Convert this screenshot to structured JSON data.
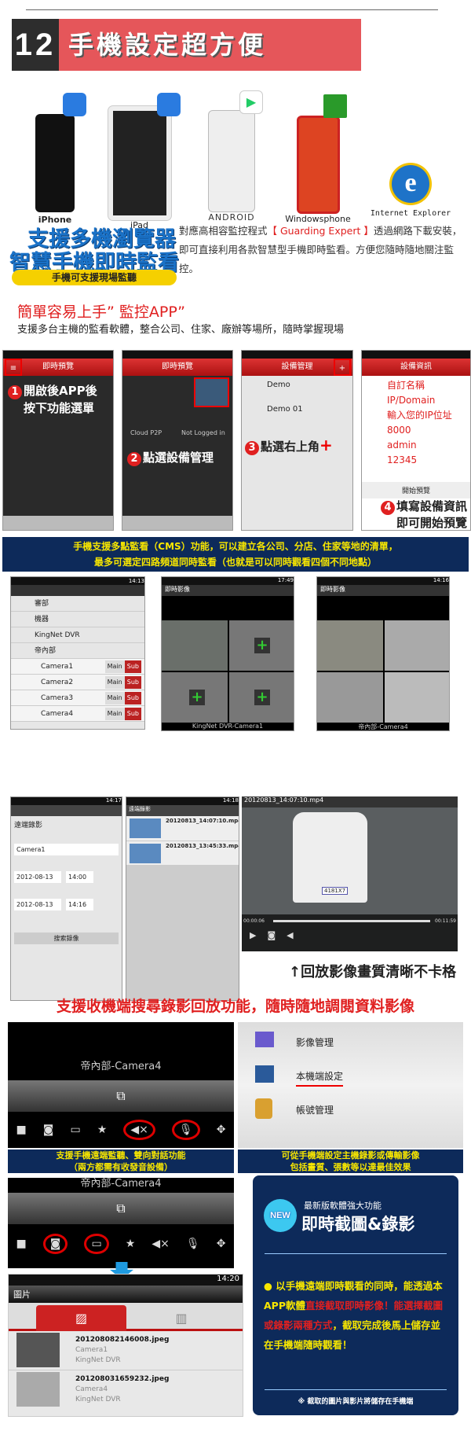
{
  "header": {
    "number": "12",
    "title": "手機設定超方便"
  },
  "devices": [
    {
      "label": "iPhone",
      "icon": "app-store-icon"
    },
    {
      "label": "iPad",
      "icon": "app-store-icon"
    },
    {
      "label": "ANDROID",
      "icon": "google-play-icon"
    },
    {
      "label": "Windowsphone",
      "icon": "windows-store-icon"
    },
    {
      "label": "Internet Explorer",
      "icon": "ie-icon"
    }
  ],
  "intro": {
    "headline1": "支援多機瀏覽器",
    "headline2": "智慧手機即時監看",
    "pill": "手機可支援現場監聽",
    "para_pre": "對應高相容監控程式",
    "para_brand": "【 Guarding Expert 】",
    "para_post": "透過網路下載安裝，即可直接利用各款智慧型手機即時監看。方便您隨時隨地關注監控。"
  },
  "easy": {
    "title": "簡單容易上手” 監控APP”",
    "subtitle": "支援多台主機的監看軟體，整合公司、住家、廠辦等場所，隨時掌握現場"
  },
  "steps": [
    {
      "num": "1",
      "text1": "開啟後APP後",
      "text2": "按下功能選單",
      "screen_title": "即時預覽"
    },
    {
      "num": "2",
      "text1": "點選設備管理",
      "screen_title": "即時預覽",
      "cloud": "Cloud P2P",
      "not_logged": "Not Logged in"
    },
    {
      "num": "3",
      "text1": "點選右上角",
      "plus": "+",
      "screen_title": "設備管理",
      "items": [
        "Demo",
        "Demo 01"
      ]
    },
    {
      "num": "4",
      "text1": "填寫設備資訊",
      "text2": "即可開始預覽",
      "screen_title": "設備資訊",
      "fields": [
        "自訂名稱",
        "IP/Domain",
        "輸入您的IP位址",
        "8000",
        "admin",
        "12345"
      ],
      "start": "開始預覽"
    }
  ],
  "cms_banner": {
    "line1": "手機支援多點監看（CMS）功能，可以建立各公司、分店、住家等地的清單，",
    "line2": "最多可選定四路頻道同時監看（也就是可以同時觀看四個不同地點）"
  },
  "list_screen": {
    "time": "14:13",
    "groups": [
      "審部",
      "機器",
      "KingNet DVR",
      "帝內部"
    ],
    "cameras": [
      "Camera1",
      "Camera2",
      "Camera3",
      "Camera4"
    ],
    "main": "Main",
    "sub": "Sub"
  },
  "live1": {
    "time": "17:49",
    "title": "即時影像",
    "caption": "KingNet DVR-Camera1"
  },
  "live2": {
    "time": "14:16",
    "title": "即時影像",
    "caption": "帝內部-Camera4"
  },
  "search_screen": {
    "time": "14:17",
    "title": "遠端錄影",
    "channel": "Camera1",
    "start_date": "2012-08-13",
    "start_time": "14:00",
    "end_date": "2012-08-13",
    "end_time": "14:16",
    "button": "搜索錄像"
  },
  "results_screen": {
    "time": "14:18",
    "title": "遠端錄影",
    "files": [
      "20120813_14:07:10.mp4",
      "20120813_13:45:33.mp4"
    ]
  },
  "video": {
    "filename": "20120813_14:07:10.mp4",
    "plate": "4181X7",
    "elapsed": "00:00:06",
    "total": "00:11:59",
    "progress": 0.01
  },
  "playback_caption": "↑回放影像畫質清晰不卡格",
  "playback_heading": "支援收機端搜尋錄影回放功能，隨時隨地調閱資料影像",
  "audio": {
    "camera": "帝內部-Camera4",
    "caption1": "支援手機遠端監聽、雙向對話功能",
    "caption2": "（兩方都需有收發音設備）"
  },
  "settings": {
    "items": [
      "影像管理",
      "本機端設定",
      "帳號管理"
    ],
    "caption1": "可從手機端設定主機錄影或傳輸影像",
    "caption2": "包括畫質、張數等以達最佳效果"
  },
  "capture_phone": {
    "camera": "帝內部-Camera4",
    "time": "14:20",
    "title": "圖片",
    "files": [
      {
        "name": "201208082146008.jpeg",
        "camera": "Camera1",
        "dvr": "KingNet DVR"
      },
      {
        "name": "201208031659232.jpeg",
        "camera": "Camera4",
        "dvr": "KingNet DVR"
      }
    ]
  },
  "newbox": {
    "badge": "NEW",
    "sub": "最新版軟體強大功能",
    "title": "即時截圖&錄影",
    "t1": "以手機遠端即時觀看的同時，能透過本APP軟體",
    "t2": "直接截取即時影像！能選擇截圖或錄影兩種方式",
    "t3": "，截取完成後馬上儲存並在手機端隨時觀看！",
    "note": "※ 截取的圖片與影片將儲存在手機端"
  },
  "colors": {
    "red": "#e02020",
    "navy": "#0d2a5a",
    "yellow": "#f7e600",
    "banner": "#e5565a"
  }
}
